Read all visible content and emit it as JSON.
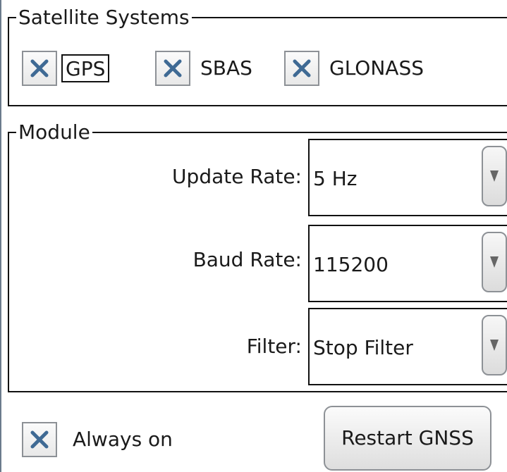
{
  "satellite_systems": {
    "title": "Satellite Systems",
    "options": [
      {
        "label": "GPS",
        "checked": true,
        "focused": true
      },
      {
        "label": "SBAS",
        "checked": true
      },
      {
        "label": "GLONASS",
        "checked": true
      }
    ]
  },
  "module": {
    "title": "Module",
    "update_rate": {
      "label": "Update Rate:",
      "value": "5 Hz"
    },
    "baud_rate": {
      "label": "Baud Rate:",
      "value": "115200"
    },
    "filter": {
      "label": "Filter:",
      "value": "Stop Filter"
    }
  },
  "always_on": {
    "label": "Always on",
    "checked": true
  },
  "restart_button": {
    "label": "Restart GNSS"
  },
  "colors": {
    "check_mark": "#3f6a94",
    "border": "#111111",
    "control_border": "#8d9196"
  },
  "icons": {
    "checkbox_mark": "x-check-icon",
    "dropdown_arrow": "dropdown-arrow-icon"
  }
}
